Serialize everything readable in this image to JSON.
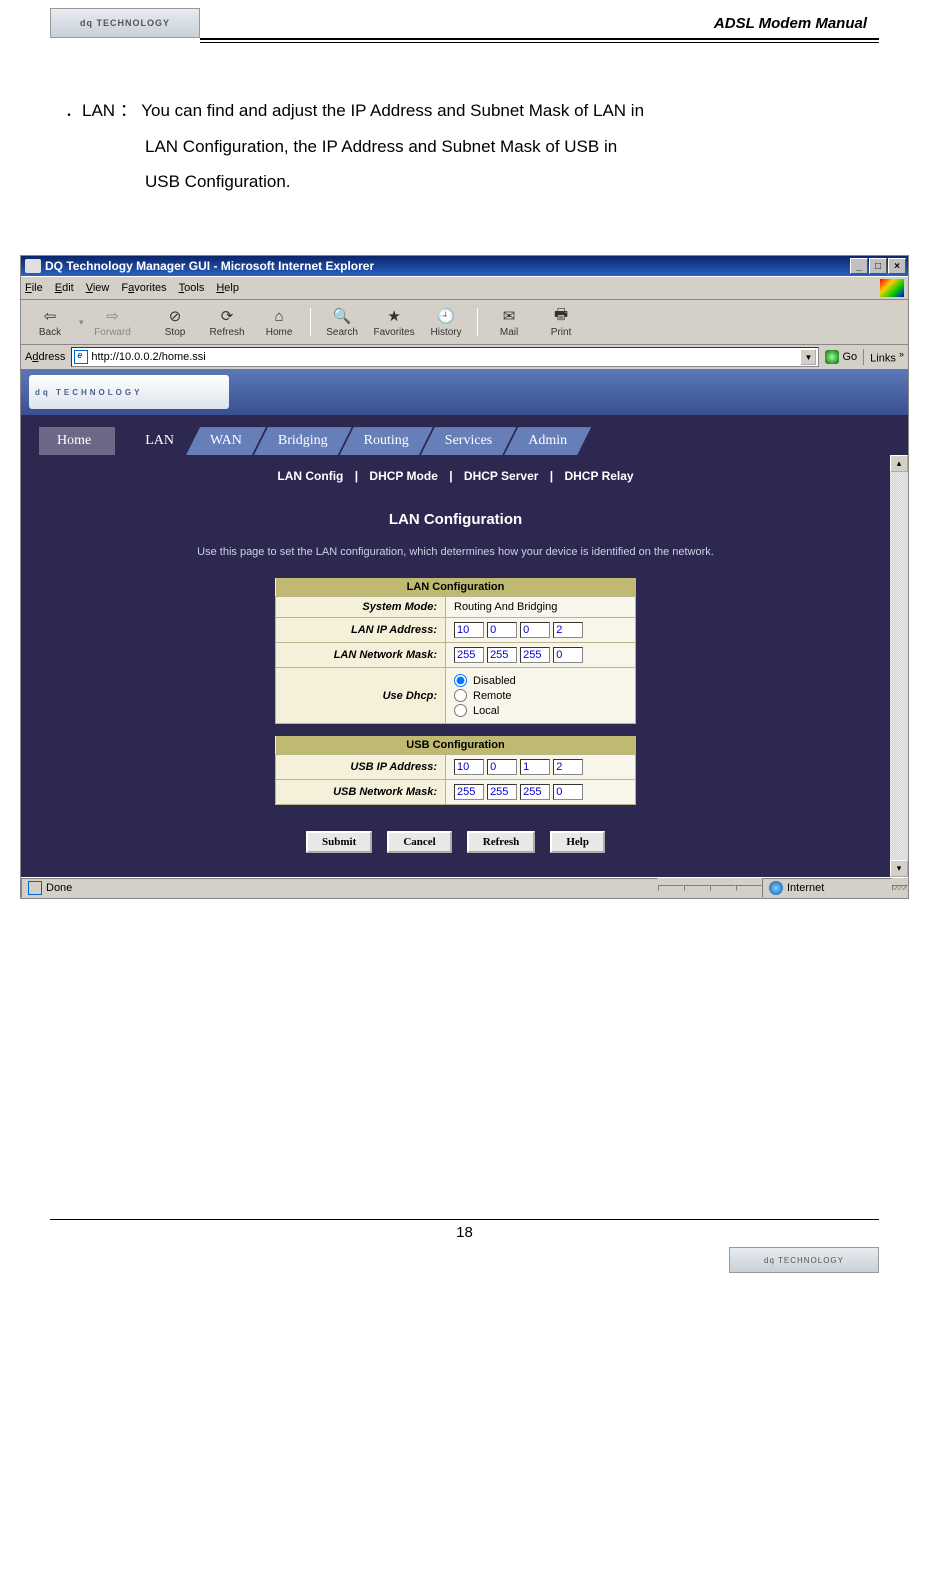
{
  "header": {
    "logo_text": "dq TECHNOLOGY",
    "title": "ADSL Modem Manual"
  },
  "doc": {
    "bullet_label": "LAN",
    "bullet_sep": "：",
    "desc_line1": "You can find and adjust the IP Address and Subnet Mask of LAN in",
    "desc_line2": "LAN Configuration, the IP Address and Subnet Mask of USB in",
    "desc_line3": "USB Configuration."
  },
  "window": {
    "title": "DQ Technology Manager GUI - Microsoft Internet Explorer",
    "menus": {
      "file": "File",
      "edit": "Edit",
      "view": "View",
      "favorites": "Favorites",
      "tools": "Tools",
      "help": "Help"
    },
    "toolbar": {
      "back": "Back",
      "forward": "Forward",
      "stop": "Stop",
      "refresh": "Refresh",
      "home": "Home",
      "search": "Search",
      "favorites2": "Favorites",
      "history": "History",
      "mail": "Mail",
      "print": "Print"
    },
    "addr_label": "Address",
    "url": "http://10.0.0.2/home.ssi",
    "go": "Go",
    "links": "Links",
    "status_done": "Done",
    "status_zone": "Internet"
  },
  "page": {
    "brand": "dq  TECHNOLOGY",
    "tabs": [
      "Home",
      "LAN",
      "WAN",
      "Bridging",
      "Routing",
      "Services",
      "Admin"
    ],
    "subtabs": [
      "LAN Config",
      "DHCP Mode",
      "DHCP Server",
      "DHCP Relay"
    ],
    "heading": "LAN Configuration",
    "description": "Use this page to set the LAN configuration, which determines how your device is identified on the network.",
    "lan_table": {
      "title": "LAN Configuration",
      "rows": {
        "system_mode_lbl": "System Mode:",
        "system_mode_val": "Routing And Bridging",
        "ip_lbl": "LAN IP Address:",
        "ip": [
          "10",
          "0",
          "0",
          "2"
        ],
        "mask_lbl": "LAN Network Mask:",
        "mask": [
          "255",
          "255",
          "255",
          "0"
        ],
        "dhcp_lbl": "Use Dhcp:",
        "dhcp_opts": [
          "Disabled",
          "Remote",
          "Local"
        ]
      }
    },
    "usb_table": {
      "title": "USB Configuration",
      "rows": {
        "ip_lbl": "USB IP Address:",
        "ip": [
          "10",
          "0",
          "1",
          "2"
        ],
        "mask_lbl": "USB Network Mask:",
        "mask": [
          "255",
          "255",
          "255",
          "0"
        ]
      }
    },
    "buttons": {
      "submit": "Submit",
      "cancel": "Cancel",
      "refresh": "Refresh",
      "help": "Help"
    }
  },
  "footer": {
    "page_num": "18",
    "logo_text": "dq TECHNOLOGY"
  }
}
